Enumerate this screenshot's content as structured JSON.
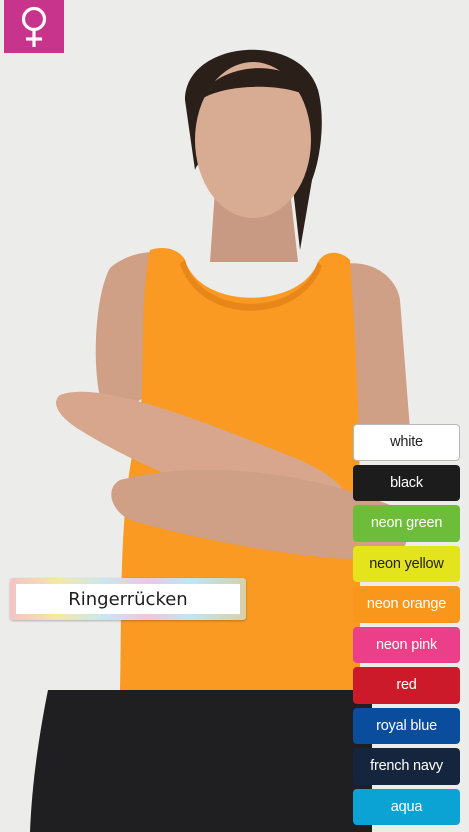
{
  "gender_badge": {
    "icon": "female-symbol-icon",
    "color": "#c8348c"
  },
  "feature_label": {
    "text": "Ringerrücken"
  },
  "colors": [
    {
      "label": "white",
      "bg": "#ffffff",
      "fg": "#222222"
    },
    {
      "label": "black",
      "bg": "#1c1c1c",
      "fg": "#ffffff"
    },
    {
      "label": "neon green",
      "bg": "#6dbd3a",
      "fg": "#ffffff"
    },
    {
      "label": "neon yellow",
      "bg": "#e4e41c",
      "fg": "#222222"
    },
    {
      "label": "neon orange",
      "bg": "#f9961c",
      "fg": "#ffffff"
    },
    {
      "label": "neon pink",
      "bg": "#ec3f8a",
      "fg": "#ffffff"
    },
    {
      "label": "red",
      "bg": "#cd1a2b",
      "fg": "#ffffff"
    },
    {
      "label": "royal blue",
      "bg": "#0a4d9c",
      "fg": "#ffffff"
    },
    {
      "label": "french navy",
      "bg": "#15253e",
      "fg": "#ffffff"
    },
    {
      "label": "aqua",
      "bg": "#0aa3d4",
      "fg": "#ffffff"
    }
  ]
}
